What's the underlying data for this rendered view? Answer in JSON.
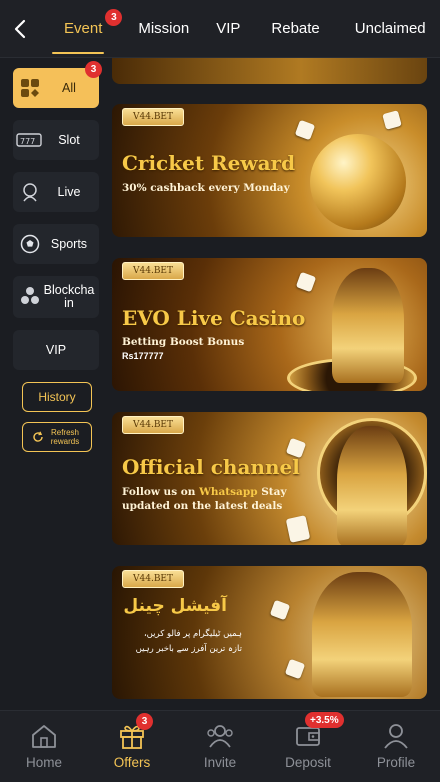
{
  "header": {
    "tabs": [
      {
        "label": "Event",
        "badge": "3",
        "active": true
      },
      {
        "label": "Mission"
      },
      {
        "label": "VIP"
      },
      {
        "label": "Rebate"
      },
      {
        "label": "Unclaimed"
      }
    ]
  },
  "sidebar": {
    "items": [
      {
        "label": "All",
        "badge": "3",
        "icon": "grid-icon",
        "active": true
      },
      {
        "label": "Slot",
        "icon": "slot-machine-icon"
      },
      {
        "label": "Live",
        "icon": "live-dealer-icon"
      },
      {
        "label": "Sports",
        "icon": "soccer-ball-icon"
      },
      {
        "label": "Blockchain",
        "icon": "blockchain-icon"
      },
      {
        "label": "VIP"
      }
    ],
    "history_label": "History",
    "refresh_label": "Refresh rewards"
  },
  "banners": [
    {
      "tag": "V44.BET",
      "title": "Cricket Reward",
      "subtitle": "30% cashback every Monday"
    },
    {
      "tag": "V44.BET",
      "title": "EVO Live Casino",
      "subtitle": "Betting Boost Bonus",
      "small": "Rs177777"
    },
    {
      "tag": "V44.BET",
      "title": "Official channel",
      "subtitle_line1_a": "Follow us on ",
      "subtitle_line1_hl": "Whatsapp",
      "subtitle_line1_b": " Stay",
      "subtitle_line2": "updated on the latest deals"
    },
    {
      "tag": "V44.BET",
      "title": "آفیشل چینل",
      "subtitle_line1": "ہمیں ٹیلیگرام پر فالو کریں،",
      "subtitle_line2": "تازہ ترین آفرز سے باخبر رہیں"
    }
  ],
  "bottom_nav": [
    {
      "label": "Home",
      "icon": "home-icon"
    },
    {
      "label": "Offers",
      "icon": "gift-icon",
      "badge": "3",
      "active": true
    },
    {
      "label": "Invite",
      "icon": "invite-users-icon"
    },
    {
      "label": "Deposit",
      "icon": "wallet-icon",
      "badge": "+3.5%"
    },
    {
      "label": "Profile",
      "icon": "user-icon"
    }
  ],
  "colors": {
    "accent": "#f3c455",
    "background": "#1b1d22",
    "badge": "#e0302f"
  }
}
